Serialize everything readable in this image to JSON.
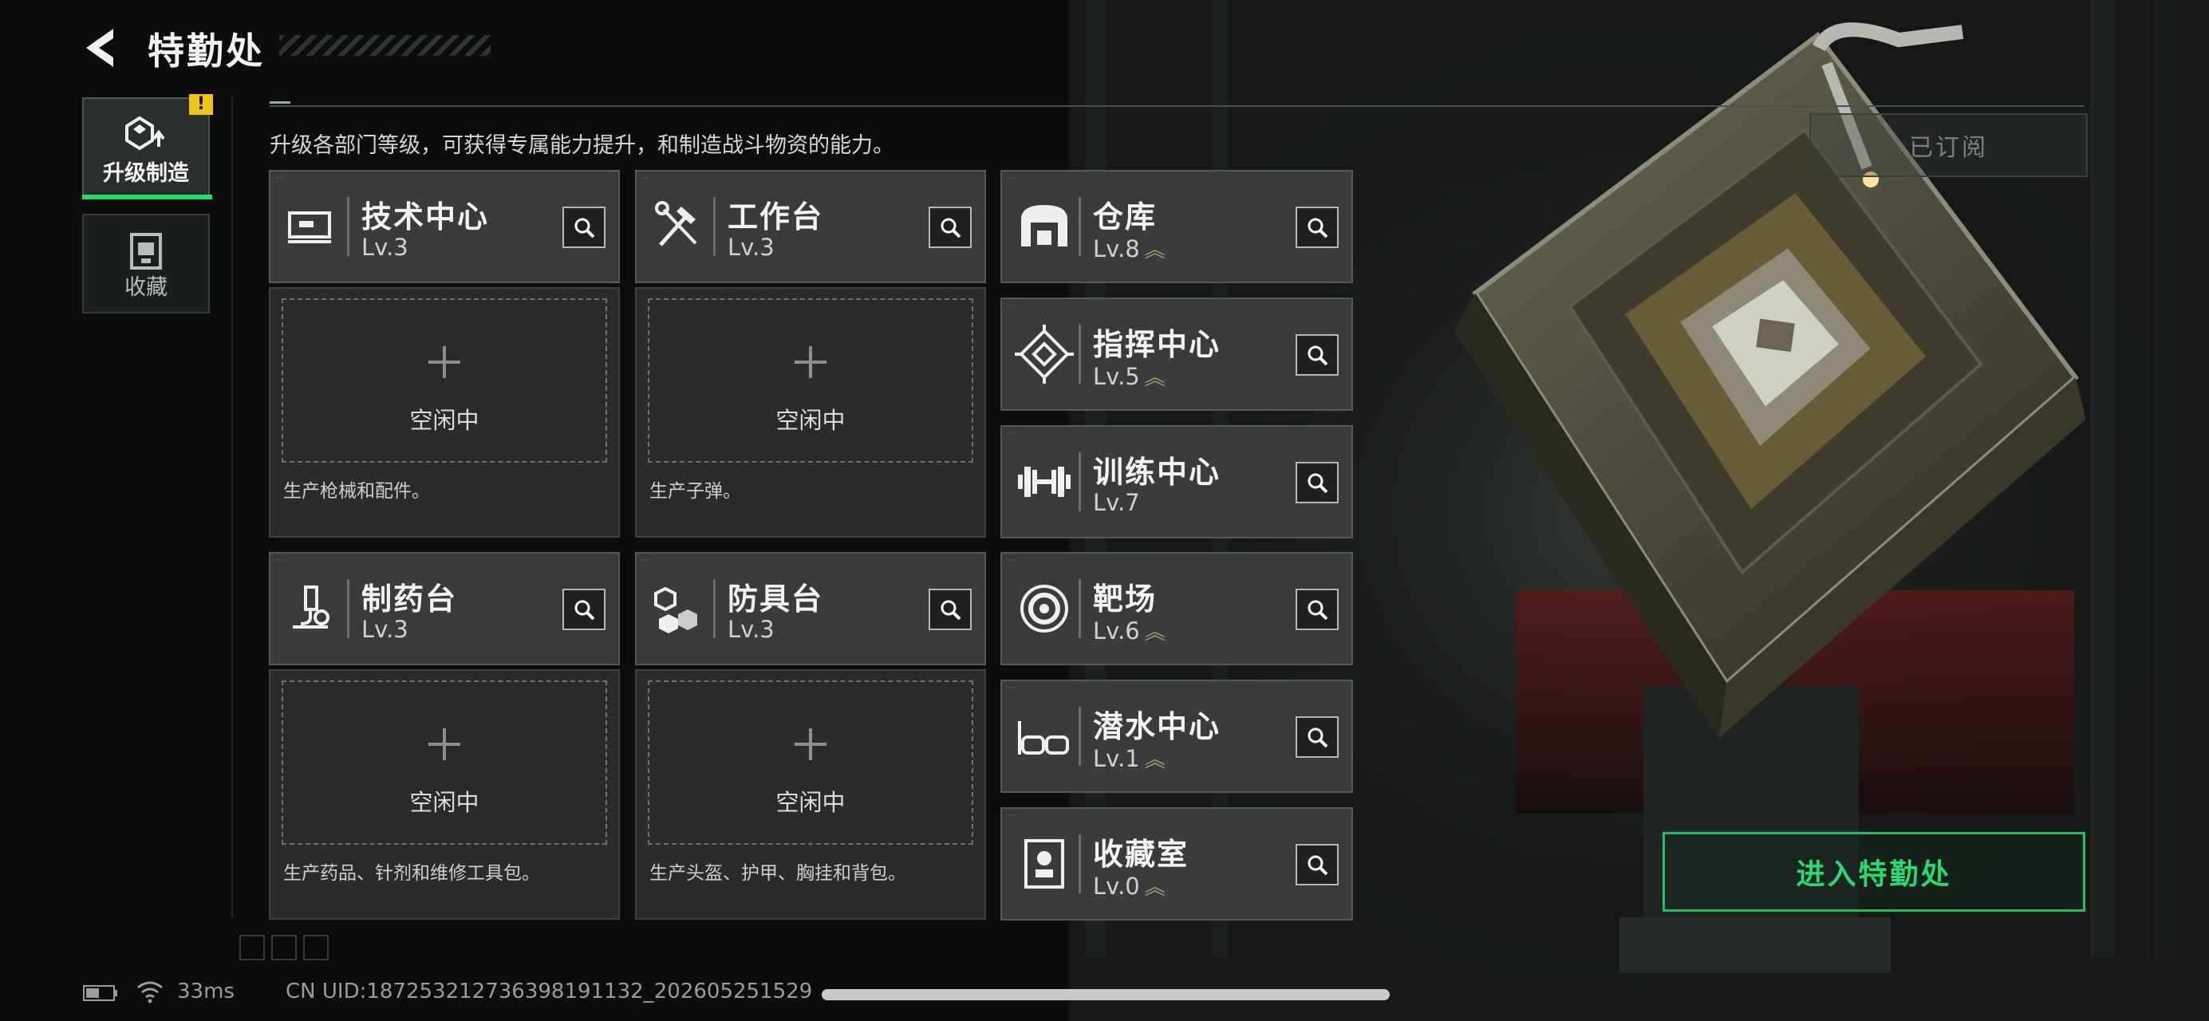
{
  "header": {
    "title": "特勤处",
    "description": "升级各部门等级，可获得专属能力提升，和制造战斗物资的能力。",
    "subscribe_label": "已订阅"
  },
  "tabs": [
    {
      "label": "升级制造",
      "alert": "!",
      "active": true
    },
    {
      "label": "收藏",
      "active": false
    }
  ],
  "facilities": {
    "tech_center": {
      "name": "技术中心",
      "level": "Lv.3",
      "icon": "monitor-icon",
      "production": {
        "status": "空闲中",
        "desc": "生产枪械和配件。"
      }
    },
    "workbench": {
      "name": "工作台",
      "level": "Lv.3",
      "icon": "hammer-wrench-icon",
      "production": {
        "status": "空闲中",
        "desc": "生产子弹。"
      }
    },
    "pharmacy": {
      "name": "制药台",
      "level": "Lv.3",
      "icon": "microscope-icon",
      "production": {
        "status": "空闲中",
        "desc": "生产药品、针剂和维修工具包。"
      }
    },
    "armor_bench": {
      "name": "防具台",
      "level": "Lv.3",
      "icon": "cubes-icon",
      "production": {
        "status": "空闲中",
        "desc": "生产头盔、护甲、胸挂和背包。"
      }
    },
    "warehouse": {
      "name": "仓库",
      "level": "Lv.8",
      "icon": "warehouse-icon",
      "upgradable": true
    },
    "command_center": {
      "name": "指挥中心",
      "level": "Lv.5",
      "icon": "diamond-target-icon",
      "upgradable": true
    },
    "training_center": {
      "name": "训练中心",
      "level": "Lv.7",
      "icon": "dumbbell-icon",
      "upgradable": false
    },
    "shooting_range": {
      "name": "靶场",
      "level": "Lv.6",
      "icon": "target-icon",
      "upgradable": true
    },
    "diving_center": {
      "name": "潜水中心",
      "level": "Lv.1",
      "icon": "goggles-icon",
      "upgradable": true
    },
    "collection_room": {
      "name": "收藏室",
      "level": "Lv.0",
      "icon": "trophy-case-icon",
      "upgradable": true
    }
  },
  "upgrade_marker": "︽",
  "enter_button": "进入特勤处",
  "status_bar": {
    "ping": "33ms",
    "uid": "CN UID:18725321273639819113​2_202605251529"
  },
  "colors": {
    "accent_green": "#26db70",
    "alert_yellow": "#f1c515",
    "upgrade_gold": "#b59a5b"
  }
}
